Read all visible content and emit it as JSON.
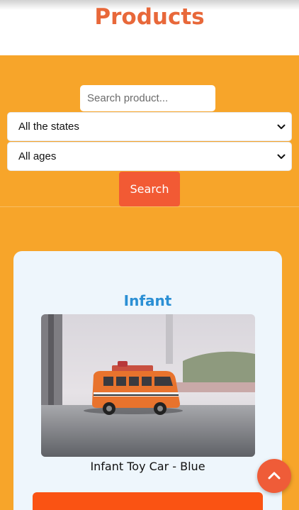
{
  "header": {
    "title": "Products"
  },
  "filters": {
    "search_placeholder": "Search product...",
    "state_select": {
      "selected": "All the states"
    },
    "age_select": {
      "selected": "All ages"
    },
    "search_button_label": "Search"
  },
  "products": [
    {
      "category": "Infant",
      "name": "Infant Toy Car - Blue"
    }
  ],
  "icons": {
    "select_chevron": "chevron-down-icon",
    "scroll_top": "chevron-up-icon"
  },
  "colors": {
    "page_bg": "#f7a52a",
    "title": "#e8683a",
    "primary_button": "#f25a34",
    "category_text": "#2b8fd4",
    "card_bg": "#eef6fc"
  }
}
